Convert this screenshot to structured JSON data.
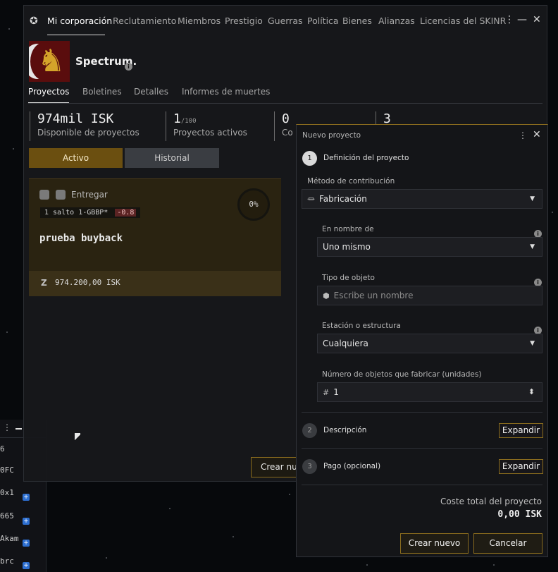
{
  "corp_window": {
    "nav": {
      "tabs": [
        {
          "label": "Mi corporación"
        },
        {
          "label": "Reclutamiento"
        },
        {
          "label": "Miembros"
        },
        {
          "label": "Prestigio"
        },
        {
          "label": "Guerras"
        },
        {
          "label": "Política"
        },
        {
          "label": "Bienes"
        },
        {
          "label": "Alianzas"
        },
        {
          "label": "Licencias del SKINR"
        }
      ],
      "more": "⋮",
      "minimize": "—",
      "close": "✕"
    },
    "corp_name": "Spectrum.",
    "subtabs": [
      "Proyectos",
      "Boletines",
      "Detalles",
      "Informes de muertes"
    ],
    "stats": [
      {
        "value": "974mil ISK",
        "label": "Disponible de proyectos"
      },
      {
        "value": "1",
        "value_suffix": "/100",
        "label": "Proyectos activos"
      },
      {
        "value": "0",
        "label": "Co"
      },
      {
        "value": "3",
        "label": ""
      }
    ],
    "toggle": {
      "active": "Activo",
      "inactive": "Historial"
    },
    "project_card": {
      "type": "Entregar",
      "route_jumps": "1 salto",
      "route_system": "1-GBBP*",
      "route_security": "-0.8",
      "progress": "0%",
      "name": "prueba buyback",
      "isk_symbol": "Z",
      "isk_amount": "974.200,00 ISK"
    },
    "create_button": "Crear nuevo"
  },
  "chat_strip": {
    "rows": [
      "6",
      "0FC",
      "0x1",
      "665",
      "Akam",
      "brc"
    ]
  },
  "dialog": {
    "title": "Nuevo proyecto",
    "more": "⋮",
    "close": "✕",
    "step1": {
      "number": "1",
      "title": "Definición del proyecto"
    },
    "contribution_method": {
      "label": "Método de contribución",
      "value": "Fabricación",
      "icon": "⏛"
    },
    "on_behalf": {
      "label": "En nombre de",
      "value": "Uno mismo"
    },
    "item_type": {
      "label": "Tipo de objeto",
      "placeholder": "Escribe un nombre",
      "icon": "⬢"
    },
    "station": {
      "label": "Estación o estructura",
      "value": "Cualquiera"
    },
    "quantity": {
      "label": "Número de objetos que fabricar (unidades)",
      "value": "1",
      "icon": "#",
      "stepper": "⬍"
    },
    "step2": {
      "number": "2",
      "title": "Descripción",
      "button": "Expandir"
    },
    "step3": {
      "number": "3",
      "title": "Pago (opcional)",
      "button": "Expandir"
    },
    "total_label": "Coste total del proyecto",
    "total_value": "0,00 ISK",
    "create_button": "Crear nuevo",
    "cancel_button": "Cancelar",
    "info_icon": "i"
  },
  "colors": {
    "accent_gold": "#8a6c1e",
    "active_tab_bg": "#6b4f10",
    "security_red": "#5b2323",
    "chat_badge": "#2d6fd1"
  }
}
